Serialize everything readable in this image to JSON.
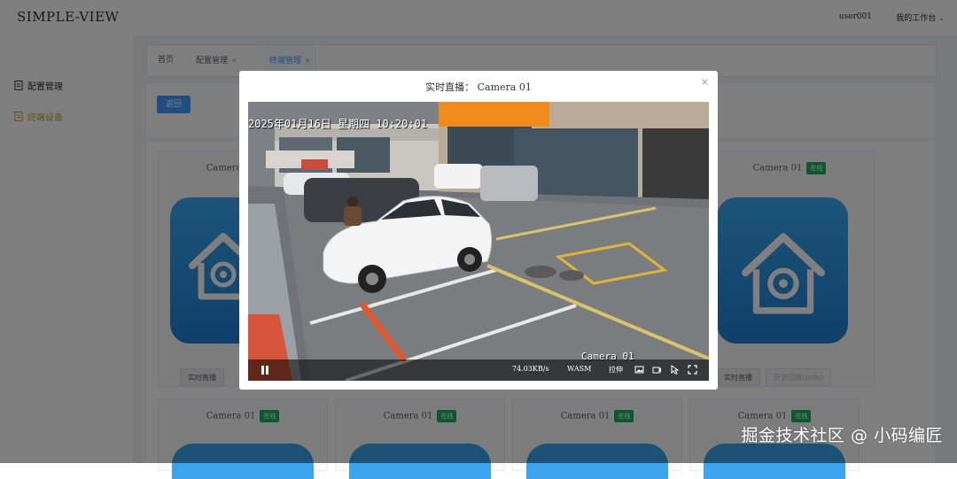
{
  "app": {
    "title": "SIMPLE-VIEW"
  },
  "header": {
    "user": "user001",
    "workspace": "我的工作台"
  },
  "sidebar": {
    "items": [
      {
        "label": "配置管理"
      },
      {
        "label": "终端设备"
      }
    ]
  },
  "tabs": [
    {
      "label": "首页"
    },
    {
      "label": "配置管理"
    },
    {
      "label": "终端管理"
    }
  ],
  "toolbar": {
    "back_label": "返回"
  },
  "cards": [
    {
      "name": "Camera 01",
      "status": "在线",
      "live_label": "实时直播",
      "playback_label": "历史回放(todo)"
    },
    {
      "name": "Camera 01",
      "status": "在线",
      "live_label": "实时直播",
      "playback_label": "历史回放(todo)"
    },
    {
      "name": "Camera 01",
      "status": "在线"
    },
    {
      "name": "Camera 01",
      "status": "在线"
    },
    {
      "name": "Camera 01",
      "status": "在线"
    },
    {
      "name": "Camera 01",
      "status": "在线"
    }
  ],
  "modal": {
    "title": "实时直播：  Camera 01",
    "close_icon": "close-icon",
    "video": {
      "osd_datetime": "2025年01月16日  星期四  10:20:01",
      "camera_label": "Camera 01",
      "bitrate": "74.03KB/s",
      "decoder": "WASM",
      "stretch_label": "拉伸"
    }
  },
  "watermark": "掘金技术社区 @ 小码编匠",
  "colors": {
    "primary": "#409eff",
    "online": "#18b35a",
    "icon_blue": "#2b8fe3"
  }
}
